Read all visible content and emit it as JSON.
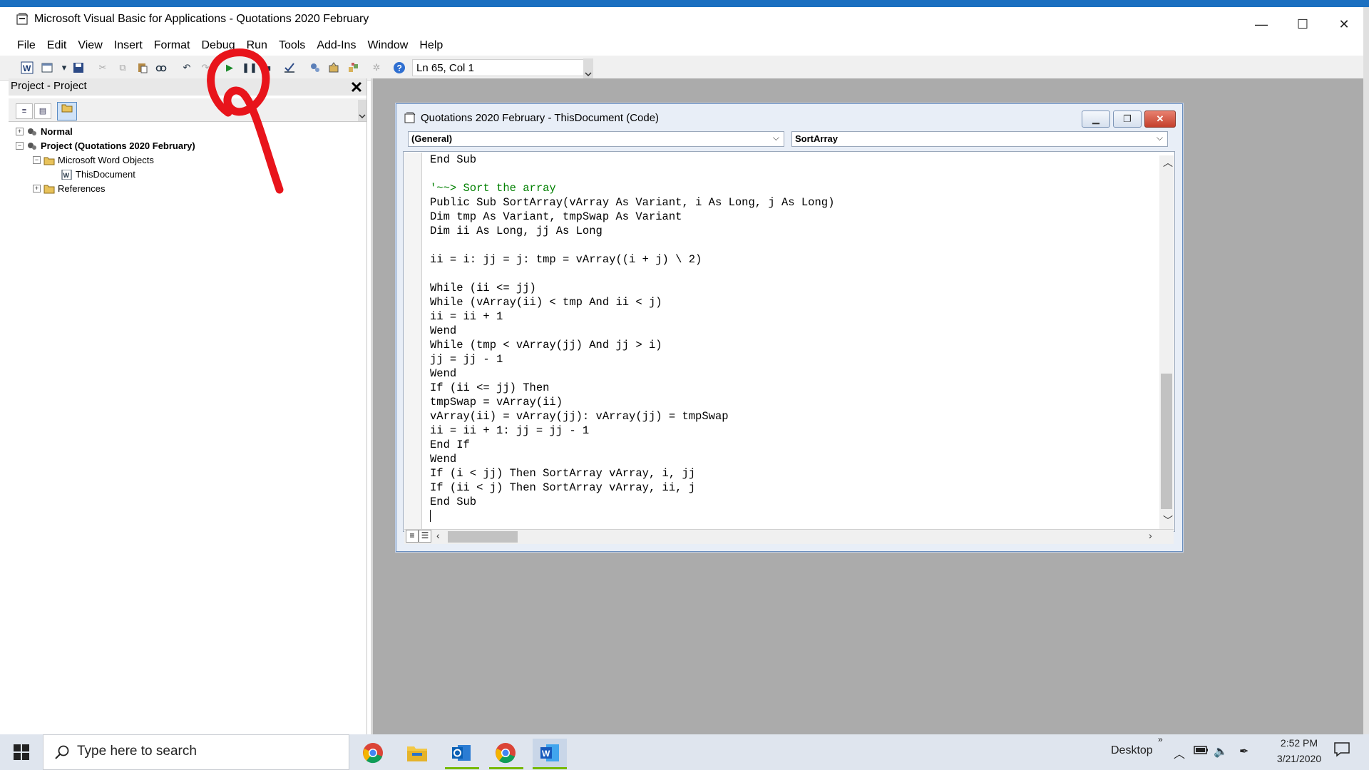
{
  "window": {
    "title": "Microsoft Visual Basic for Applications - Quotations 2020 February",
    "minimize": "—",
    "maximize": "☐",
    "close": "✕"
  },
  "menu": [
    "File",
    "Edit",
    "View",
    "Insert",
    "Format",
    "Debug",
    "Run",
    "Tools",
    "Add-Ins",
    "Window",
    "Help"
  ],
  "toolbar": {
    "position": "Ln 65, Col 1"
  },
  "project": {
    "title": "Project - Project",
    "tree": [
      {
        "label": "Normal",
        "bold": true
      },
      {
        "label": "Project (Quotations 2020 February)",
        "bold": true
      },
      {
        "label": "Microsoft Word Objects",
        "bold": false
      },
      {
        "label": "ThisDocument",
        "bold": false
      },
      {
        "label": "References",
        "bold": false
      }
    ]
  },
  "code_window": {
    "title": "Quotations 2020 February - ThisDocument (Code)",
    "object_combo": "(General)",
    "proc_combo": "SortArray",
    "lines": [
      "End Sub",
      "",
      "'~~> Sort the array",
      "Public Sub SortArray(vArray As Variant, i As Long, j As Long)",
      "Dim tmp As Variant, tmpSwap As Variant",
      "Dim ii As Long, jj As Long",
      "",
      "ii = i: jj = j: tmp = vArray((i + j) \\ 2)",
      "",
      "While (ii <= jj)",
      "While (vArray(ii) < tmp And ii < j)",
      "ii = ii + 1",
      "Wend",
      "While (tmp < vArray(jj) And jj > i)",
      "jj = jj - 1",
      "Wend",
      "If (ii <= jj) Then",
      "tmpSwap = vArray(ii)",
      "vArray(ii) = vArray(jj): vArray(jj) = tmpSwap",
      "ii = ii + 1: jj = jj - 1",
      "End If",
      "Wend",
      "If (i < jj) Then SortArray vArray, i, jj",
      "If (ii < j) Then SortArray vArray, ii, j",
      "End Sub"
    ]
  },
  "taskbar": {
    "search_placeholder": "Type here to search",
    "desktop_label": "Desktop",
    "time": "2:52 PM",
    "date": "3/21/2020"
  },
  "colors": {
    "title_accent": "#1b6fc0",
    "comment_green": "#008000",
    "annotation_red": "#e8141b"
  }
}
